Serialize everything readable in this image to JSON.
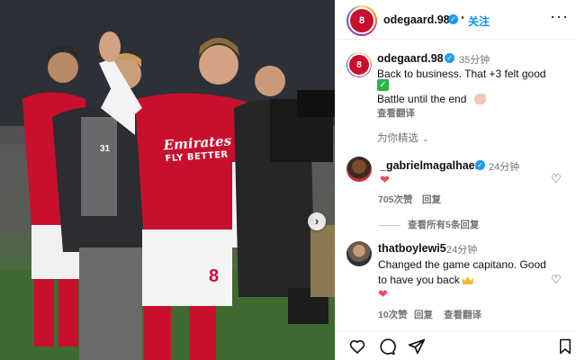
{
  "post": {
    "header": {
      "handle": "odegaard.98",
      "dot": "•",
      "follow_label": "关注",
      "more_label": "···",
      "avatar_number": "8"
    },
    "caption": {
      "handle": "odegaard.98",
      "time": "35分钟",
      "text": "Back to business. That +3 felt good",
      "check_emoji": "✓",
      "text2": "Battle until the end",
      "see_translation": "查看翻译"
    },
    "sort_label": "为你精选",
    "sort_chevron": "⌄",
    "comments": [
      {
        "handle": "_gabrielmagalhaes",
        "verified": true,
        "time": "24分钟",
        "text": "❤",
        "likes": "705次赞",
        "reply_label": "回复"
      },
      {
        "handle": "thatboylewi5",
        "verified": false,
        "time": "24分钟",
        "text": "Changed the game capitano. Good to have you back",
        "heart": "❤",
        "likes": "10次赞",
        "reply_label": "回复",
        "translate_label": "查看翻译"
      }
    ],
    "more_replies_label": "查看所有5条回复",
    "photo": {
      "sponsor_line1": "Emirates",
      "sponsor_line2": "FLY BETTER",
      "shirt_number": "8",
      "carousel_next": "›",
      "other_number": "31"
    }
  },
  "colors": {
    "arsenal_red": "#c8102e",
    "instagram_blue": "#0095f6",
    "verified_blue": "#1d9bf0",
    "like_red": "#ed4956",
    "muted_gray": "#737373"
  }
}
